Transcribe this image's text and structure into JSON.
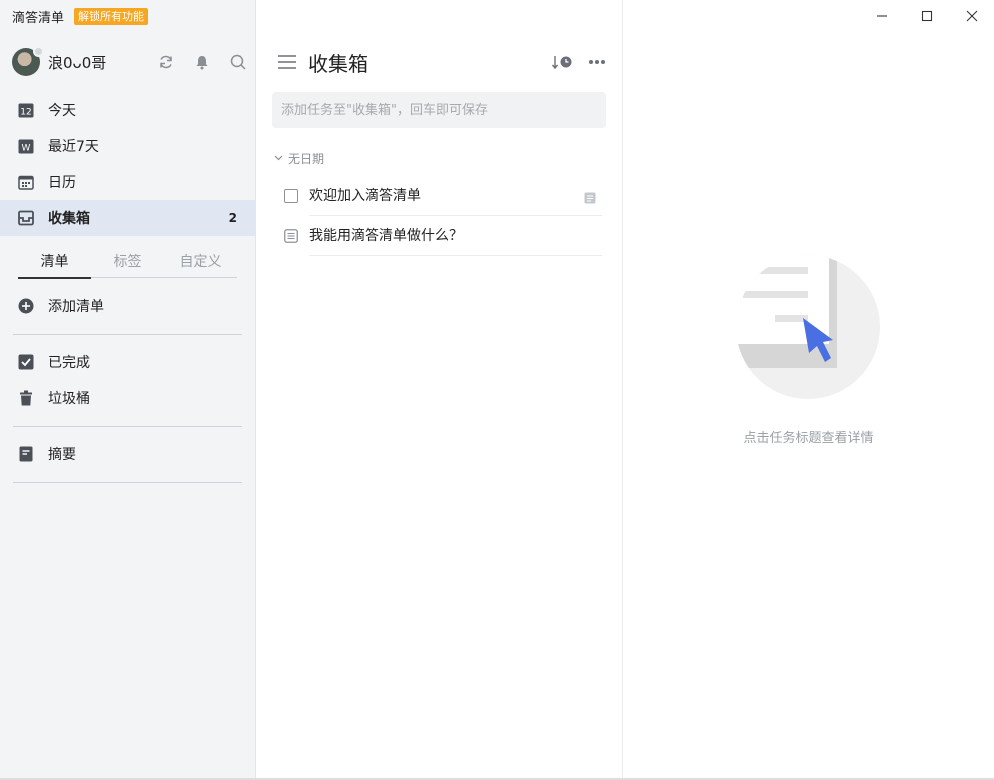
{
  "window": {
    "app_name": "滴答清单",
    "unlock_badge": "解锁所有功能",
    "controls": [
      "minimize-icon",
      "maximize-icon",
      "close-icon"
    ]
  },
  "profile": {
    "username": "浪0ᴗ0哥",
    "actions": [
      "sync-icon",
      "bell-icon",
      "search-icon"
    ]
  },
  "nav": {
    "items": [
      {
        "label": "今天",
        "icon": "calendar-day-icon",
        "icon_text": "12"
      },
      {
        "label": "最近7天",
        "icon": "calendar-week-icon",
        "icon_text": "W"
      },
      {
        "label": "日历",
        "icon": "calendar-icon"
      },
      {
        "label": "收集箱",
        "icon": "inbox-icon",
        "count": "2",
        "active": true
      }
    ]
  },
  "list_tabs": [
    "清单",
    "标签",
    "自定义"
  ],
  "sidebar": {
    "add_list": "添加清单",
    "completed": "已完成",
    "trash": "垃圾桶",
    "summary": "摘要"
  },
  "main": {
    "title": "收集箱",
    "add_placeholder": "添加任务至\"收集箱\"，回车即可保存",
    "group_label": "无日期",
    "tasks": [
      {
        "title": "欢迎加入滴答清单",
        "type": "checkbox",
        "has_note": true
      },
      {
        "title": "我能用滴答清单做什么？",
        "type": "note"
      }
    ]
  },
  "detail": {
    "empty_text": "点击任务标题查看详情"
  },
  "colors": {
    "accent": "#4a6fe3",
    "badge": "#f5a623",
    "active_bg": "#e0e6f2",
    "sidebar_bg": "#f3f4f6"
  }
}
